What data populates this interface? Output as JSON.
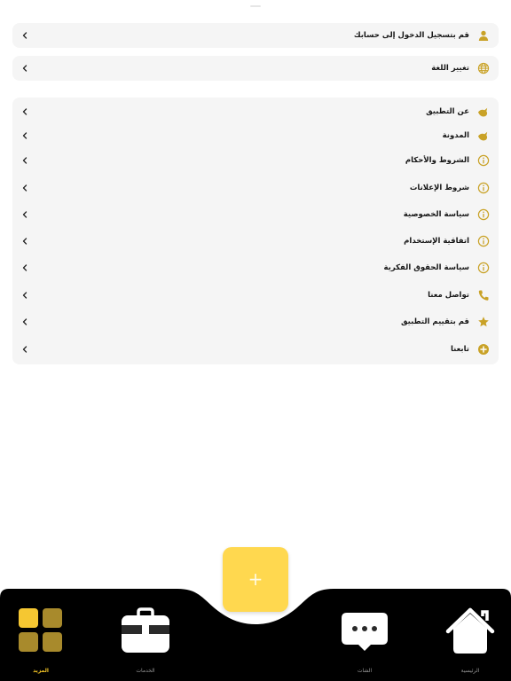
{
  "account": {
    "login_label": "قم بتسجيل الدخول إلى حسابك",
    "icon": "person-icon"
  },
  "language": {
    "label": "تغيير اللغة",
    "icon": "globe-icon"
  },
  "menu": {
    "items": [
      {
        "label": "عن التطبيق",
        "icon": "bird-icon"
      },
      {
        "label": "المدونة",
        "icon": "bird-icon"
      },
      {
        "label": "الشروط والأحكام",
        "icon": "info-icon"
      },
      {
        "label": "شروط الإعلانات",
        "icon": "info-icon"
      },
      {
        "label": "سياسة الخصوصية",
        "icon": "info-icon"
      },
      {
        "label": "اتفاقية الإستخدام",
        "icon": "info-icon"
      },
      {
        "label": "سياسة الحقوق الفكرية",
        "icon": "info-icon"
      },
      {
        "label": "تواصل معنا",
        "icon": "phone-icon"
      },
      {
        "label": "قم بتقييم التطبيق",
        "icon": "star-icon"
      },
      {
        "label": "تابعنا",
        "icon": "plus-circle-icon"
      }
    ]
  },
  "fab": {
    "symbol": "+"
  },
  "tabs": [
    {
      "label": "المزيد",
      "icon": "grid-icon",
      "active": true
    },
    {
      "label": "الخدمات",
      "icon": "briefcase-icon",
      "active": false
    },
    {
      "label": "الشات",
      "icon": "chat-icon",
      "active": false
    },
    {
      "label": "الرئيسية",
      "icon": "home-icon",
      "active": false
    }
  ],
  "colors": {
    "accent": "#f3c426",
    "icon_gold": "#c9a227",
    "fab": "#ffd84f",
    "dock": "#000000",
    "card": "#f5f5f5"
  }
}
